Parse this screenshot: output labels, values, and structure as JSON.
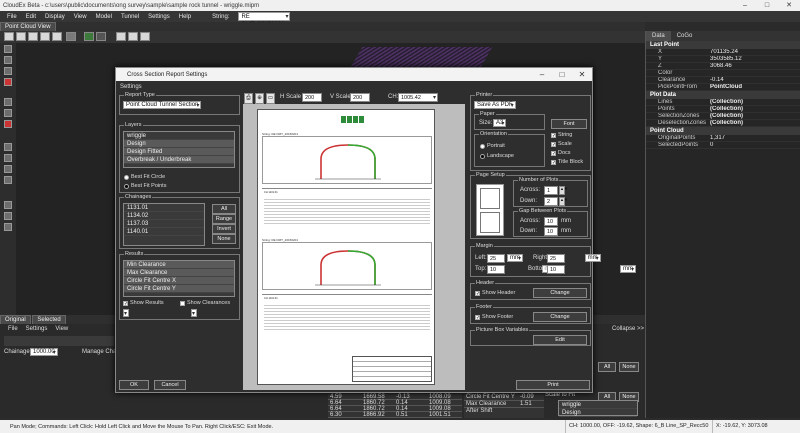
{
  "window": {
    "title": "CloudEx Beta - c:\\users\\public\\documents\\ong survey\\sample\\sample rock tunnel - wriggle.mipm"
  },
  "menu": [
    "File",
    "Edit",
    "Display",
    "View",
    "Model",
    "Tunnel",
    "Settings",
    "Help"
  ],
  "string_label": "String:",
  "string_value": "RE DMT_20150201",
  "doc_tab": "Point Cloud View",
  "bottom_tabs": [
    "Original",
    "Selected"
  ],
  "lower": {
    "menu": [
      "File",
      "Settings",
      "View"
    ],
    "chainage_label": "Chainage:",
    "chainage_value": "1000.00",
    "manage_label": "Manage Chai",
    "collapse": "Collapse >>",
    "all": "All",
    "none": "None",
    "scale_to_fit": "Scale to Fit",
    "grid_rows": [
      [
        "4.59",
        "1669.58",
        "-0.13",
        "1008.09"
      ],
      [
        "6.64",
        "1860.72",
        "0.14",
        "1009.08"
      ],
      [
        "6.64",
        "1860.72",
        "0.14",
        "1009.08"
      ],
      [
        "6.30",
        "1866.92",
        "0.51",
        "1001.51"
      ]
    ],
    "result_rows": [
      "Circle Fit Centre Y",
      "Max Clearance After Shift"
    ],
    "result_vals": [
      "-0.09",
      "1.51"
    ],
    "side_list": [
      "wriggle",
      "Design"
    ]
  },
  "right_panel": {
    "tabs": [
      "Data",
      "CoGo"
    ],
    "sections": [
      {
        "header": "Last Point",
        "rows": [
          [
            "X",
            "701135.24"
          ],
          [
            "Y",
            "3503585.12"
          ],
          [
            "Z",
            "3068.46"
          ],
          [
            "Color",
            ""
          ],
          [
            "Clearance",
            "-0.14"
          ],
          [
            "PickPointFrom",
            "PointCloud"
          ]
        ]
      },
      {
        "header": "Plot Data",
        "rows": [
          [
            "Lines",
            "(Collection)"
          ],
          [
            "Points",
            "(Collection)"
          ],
          [
            "SelectionZones",
            "(Collection)"
          ],
          [
            "DeselectionZones",
            "(Collection)"
          ]
        ]
      },
      {
        "header": "Point Cloud",
        "rows": [
          [
            "OriginalPoints",
            "1,317"
          ],
          [
            "SelectedPoints",
            "0"
          ]
        ]
      }
    ]
  },
  "dialog": {
    "title": "Cross Section Report Settings",
    "subtitle": "Settings",
    "report_type_label": "Report Type",
    "report_type_value": "Point Cloud Tunnel Section",
    "layers_label": "Layers",
    "layers": [
      "wriggle",
      "Design",
      "Design Fitted",
      "Overbreak / Underbreak"
    ],
    "best_fit_circle": "Best Fit Circle",
    "best_fit_points": "Best Fit Points",
    "chainages_label": "Chainages",
    "chainages": [
      "1131.01",
      "1134.02",
      "1137.03",
      "1140.01"
    ],
    "chainage_buttons": [
      "All",
      "Range",
      "Invert",
      "None"
    ],
    "results_label": "Results",
    "results": [
      "Min Clearance",
      "Max Clearance",
      "Circle Fit Centre X",
      "Circle Fit Centre Y"
    ],
    "show_results": "Show Results",
    "show_clearances": "Show Clearances",
    "ok": "OK",
    "cancel": "Cancel",
    "h_scale_label": "H Scale",
    "h_scale": "200",
    "v_scale_label": "V Scale",
    "v_scale": "200",
    "ch_label": "CH:",
    "ch_value": "1005.42",
    "printer_label": "Printer",
    "printer_value": "Save As PDF",
    "paper_label": "Paper",
    "size_label": "Size:",
    "size_value": "A3",
    "font_btn": "Font",
    "orientation_label": "Orientation",
    "portrait": "Portrait",
    "landscape": "Landscape",
    "opts": [
      "String",
      "Scale",
      "Docs",
      "Title Block"
    ],
    "page_setup_label": "Page Setup",
    "num_plots_label": "Number of Plots",
    "across_label": "Across:",
    "across": "1",
    "down_label": "Down:",
    "down": "2",
    "gap_label": "Gap Between Plots",
    "gap_across_label": "Across:",
    "gap_across": "10",
    "gap_down_label": "Down:",
    "gap_down": "10",
    "mm": "mm",
    "margin_label": "Margin",
    "margin_left_label": "Left:",
    "margin_left": "25",
    "margin_right_label": "Right:",
    "margin_right": "25",
    "margin_top_label": "Top:",
    "margin_top": "10",
    "margin_bottom_label": "Bottom:",
    "margin_bottom": "10",
    "header_label": "Header",
    "show_header": "Show Header",
    "change": "Change",
    "footer_label": "Footer",
    "show_footer": "Show Footer",
    "pic_vars_label": "Picture Box Variables",
    "edit": "Edit",
    "print": "Print",
    "preview_title": "String: RE DMT_20150201",
    "preview_chainage": "CH 1131.01"
  },
  "status": {
    "text": "Pan Mode; Commands: Left Click: Hold Left Click and Move the Mouse To Pan. Right Click/ESC: Exit Mode.",
    "ch": "CH: 1000.00, OFF: -19.62, Shape: 6_B Line_SP_Recc50",
    "xy": "X: -19.62, Y: 3073.08"
  }
}
